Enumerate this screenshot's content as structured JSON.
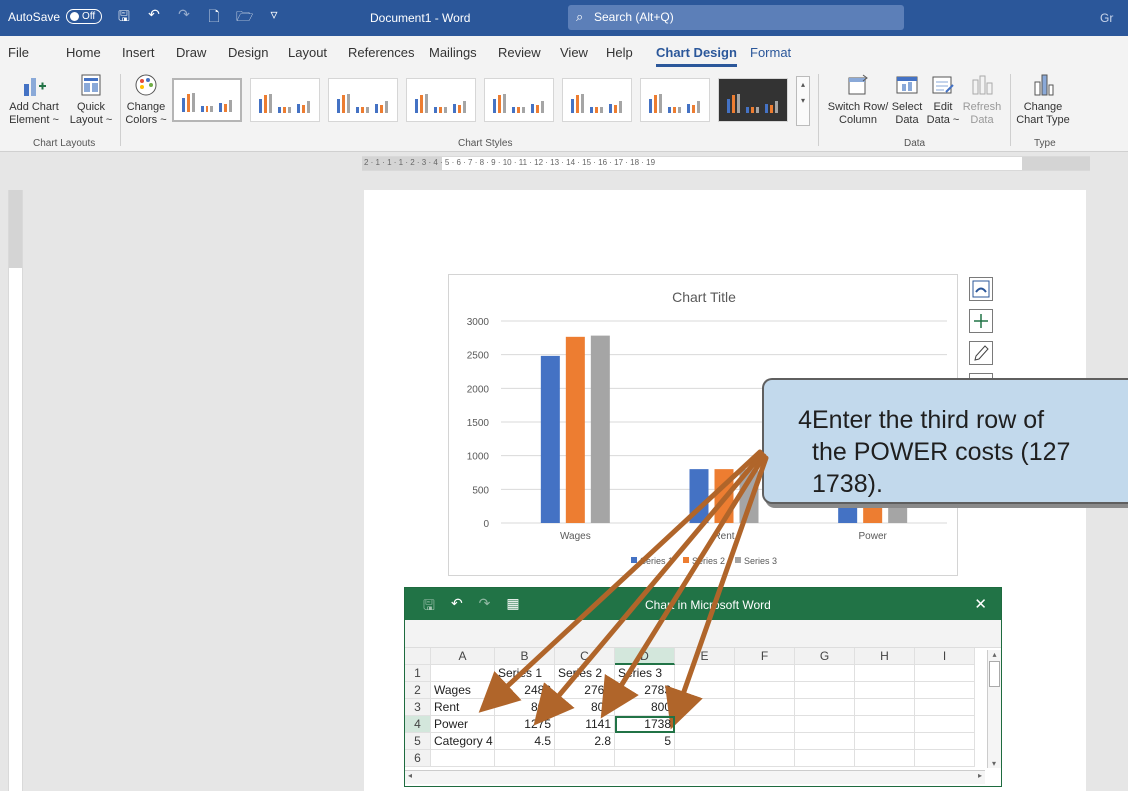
{
  "titlebar": {
    "autosave_label": "AutoSave",
    "autosave_state": "Off",
    "doc_title": "Document1  -  Word",
    "search_placeholder": "Search (Alt+Q)",
    "user_initials": "Gr"
  },
  "menu": {
    "tabs": [
      "File",
      "Home",
      "Insert",
      "Draw",
      "Design",
      "Layout",
      "References",
      "Mailings",
      "Review",
      "View",
      "Help",
      "Chart Design",
      "Format"
    ],
    "active_tab": "Chart Design"
  },
  "ribbon": {
    "add_chart_element": "Add Chart Element ~",
    "quick_layout": "Quick Layout ~",
    "change_colors": "Change Colors ~",
    "switch_row_column": "Switch Row/ Column",
    "select_data": "Select Data",
    "edit_data": "Edit Data ~",
    "refresh_data": "Refresh Data",
    "change_chart_type": "Change Chart Type",
    "groups": {
      "chart_layouts": "Chart Layouts",
      "chart_styles": "Chart Styles",
      "data": "Data",
      "type": "Type"
    }
  },
  "ruler": {
    "h_labels": "2 · 1 · 1 · 1 · 2 · 3 · 4 · 5 · 6 · 7 · 8 · 9 · 10 · 11 · 12 · 13 · 14 · 15 · 16 · 17 · 18 · 19",
    "corner": "L"
  },
  "chart_data": {
    "type": "bar",
    "title": "Chart Title",
    "categories": [
      "Wages",
      "Rent",
      "Power"
    ],
    "series": [
      {
        "name": "Series 1",
        "values": [
          2482,
          800,
          1275
        ],
        "color": "#4472c4"
      },
      {
        "name": "Series 2",
        "values": [
          2765,
          800,
          1141
        ],
        "color": "#ed7d31"
      },
      {
        "name": "Series 3",
        "values": [
          2783,
          800,
          1738
        ],
        "color": "#a5a5a5"
      }
    ],
    "ylim": [
      0,
      3000
    ],
    "yticks": [
      0,
      500,
      1000,
      1500,
      2000,
      2500,
      3000
    ],
    "grid": true,
    "legend": "bottom"
  },
  "callout": {
    "number": "4",
    "line1": "Enter the third row of",
    "line2": "the POWER costs (127",
    "line3": "1738)."
  },
  "excel": {
    "title": "Chart in Microsoft Word",
    "columns": [
      "A",
      "B",
      "C",
      "D",
      "E",
      "F",
      "G",
      "H",
      "I"
    ],
    "rows": [
      {
        "n": "1",
        "cells": [
          "",
          "Series 1",
          "Series 2",
          "Series 3"
        ]
      },
      {
        "n": "2",
        "cells": [
          "Wages",
          "2482",
          "2765",
          "2783"
        ]
      },
      {
        "n": "3",
        "cells": [
          "Rent",
          "800",
          "800",
          "800"
        ]
      },
      {
        "n": "4",
        "cells": [
          "Power",
          "1275",
          "1141",
          "1738"
        ]
      },
      {
        "n": "5",
        "cells": [
          "Category 4",
          "4.5",
          "2.8",
          "5"
        ]
      },
      {
        "n": "6",
        "cells": [
          "",
          "",
          "",
          ""
        ]
      }
    ]
  },
  "colors": {
    "word_blue": "#2b579a",
    "excel_green": "#217346",
    "arrow": "#b0652a",
    "callout_fill": "#c2d9ec"
  }
}
